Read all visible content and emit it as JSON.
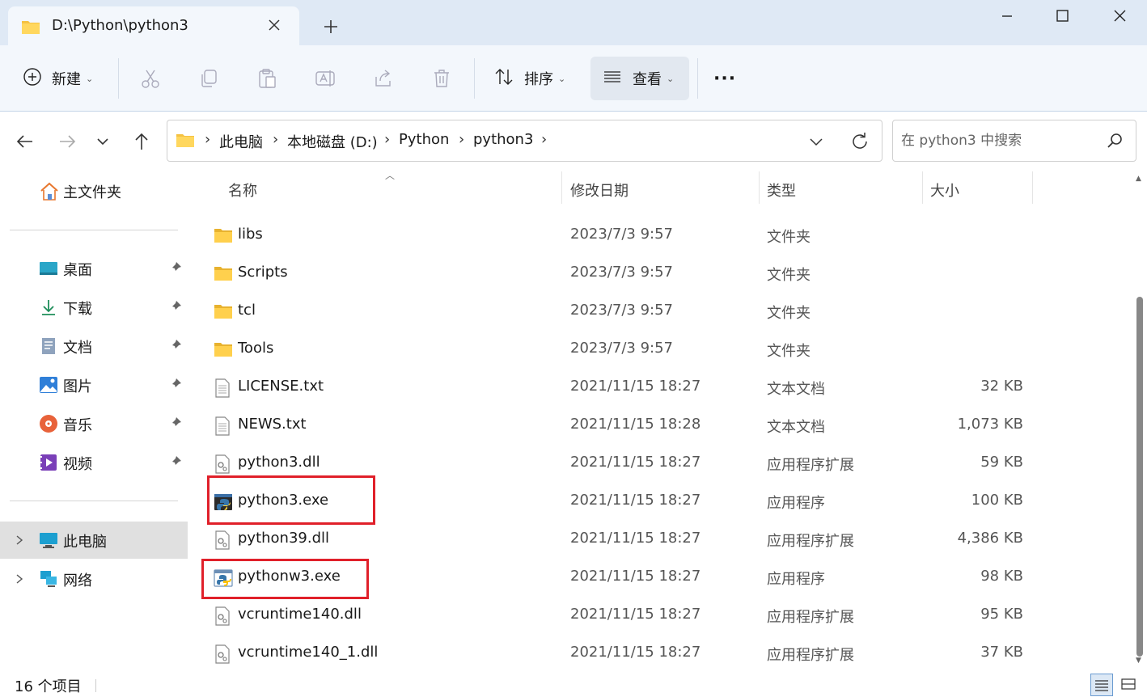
{
  "window": {
    "tab_title": "D:\\Python\\python3",
    "new_tab_label": "+",
    "minimize_label": "—",
    "maximize_label": "☐",
    "close_label": "✕"
  },
  "toolbar": {
    "new_label": "新建",
    "sort_label": "排序",
    "view_label": "查看",
    "more_label": "···"
  },
  "address": {
    "crumbs": [
      "此电脑",
      "本地磁盘 (D:)",
      "Python",
      "python3"
    ]
  },
  "search": {
    "placeholder": "在 python3 中搜索"
  },
  "sidebar": {
    "home": "主文件夹",
    "pinned": [
      {
        "label": "桌面",
        "icon": "desktop-icon"
      },
      {
        "label": "下载",
        "icon": "download-icon"
      },
      {
        "label": "文档",
        "icon": "documents-icon"
      },
      {
        "label": "图片",
        "icon": "pictures-icon"
      },
      {
        "label": "音乐",
        "icon": "music-icon"
      },
      {
        "label": "视频",
        "icon": "videos-icon"
      }
    ],
    "this_pc": "此电脑",
    "network": "网络"
  },
  "columns": {
    "name": "名称",
    "modified": "修改日期",
    "type": "类型",
    "size": "大小"
  },
  "files": [
    {
      "name": "libs",
      "modified": "2023/7/3 9:57",
      "type": "文件夹",
      "size": "",
      "icon": "folder-icon"
    },
    {
      "name": "Scripts",
      "modified": "2023/7/3 9:57",
      "type": "文件夹",
      "size": "",
      "icon": "folder-icon"
    },
    {
      "name": "tcl",
      "modified": "2023/7/3 9:57",
      "type": "文件夹",
      "size": "",
      "icon": "folder-icon"
    },
    {
      "name": "Tools",
      "modified": "2023/7/3 9:57",
      "type": "文件夹",
      "size": "",
      "icon": "folder-icon"
    },
    {
      "name": "LICENSE.txt",
      "modified": "2021/11/15 18:27",
      "type": "文本文档",
      "size": "32 KB",
      "icon": "text-file-icon"
    },
    {
      "name": "NEWS.txt",
      "modified": "2021/11/15 18:28",
      "type": "文本文档",
      "size": "1,073 KB",
      "icon": "text-file-icon"
    },
    {
      "name": "python3.dll",
      "modified": "2021/11/15 18:27",
      "type": "应用程序扩展",
      "size": "59 KB",
      "icon": "dll-file-icon"
    },
    {
      "name": "python3.exe",
      "modified": "2021/11/15 18:27",
      "type": "应用程序",
      "size": "100 KB",
      "icon": "python-console-icon"
    },
    {
      "name": "python39.dll",
      "modified": "2021/11/15 18:27",
      "type": "应用程序扩展",
      "size": "4,386 KB",
      "icon": "dll-file-icon"
    },
    {
      "name": "pythonw3.exe",
      "modified": "2021/11/15 18:27",
      "type": "应用程序",
      "size": "98 KB",
      "icon": "python-window-icon"
    },
    {
      "name": "vcruntime140.dll",
      "modified": "2021/11/15 18:27",
      "type": "应用程序扩展",
      "size": "95 KB",
      "icon": "dll-file-icon"
    },
    {
      "name": "vcruntime140_1.dll",
      "modified": "2021/11/15 18:27",
      "type": "应用程序扩展",
      "size": "37 KB",
      "icon": "dll-file-icon"
    }
  ],
  "status": {
    "count": "16 个项目"
  },
  "colors": {
    "highlight": "#e0202a",
    "folder": "#f5c242",
    "titlebar": "#dfe9f5"
  }
}
